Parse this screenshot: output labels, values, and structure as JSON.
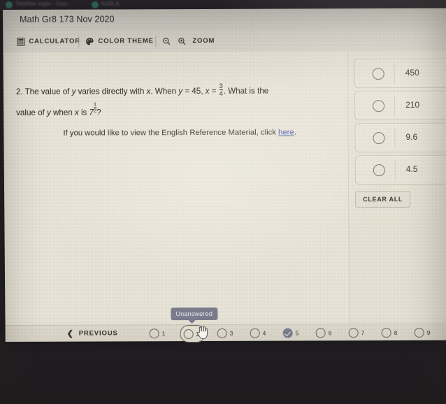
{
  "browser": {
    "tab_1_title": "TestNav login - Goo...",
    "tab_2_title": "NJSLA"
  },
  "assessment": {
    "title": "Math Gr8 173 Nov 2020"
  },
  "toolbar": {
    "calculator_label": "CALCULATOR",
    "calculator_icon": "calculator-icon",
    "color_theme_label": "COLOR THEME",
    "color_theme_icon": "palette-icon",
    "zoom_label": "ZOOM",
    "zoom_out_icon": "magnifier-minus-icon",
    "zoom_in_icon": "magnifier-plus-icon"
  },
  "question": {
    "number": "2.",
    "line1_a": "The value of ",
    "var_y": "y",
    "line1_b": " varies directly with ",
    "var_x": "x",
    "line1_c": ". When ",
    "line1_d": " = 45, ",
    "line1_e": " = ",
    "fraction_numerator": "3",
    "fraction_denominator": "4",
    "line1_f": ". What is the",
    "line2_a": "value of ",
    "line2_b": " when ",
    "line2_c": " is ",
    "mixed_whole": "7",
    "mixed_numerator": "1",
    "mixed_denominator": "2",
    "line2_d": "?",
    "reference_text": "If you would like to view the English Reference Material, click ",
    "reference_link": "here",
    "reference_period": "."
  },
  "answers": {
    "options": [
      {
        "value": "450",
        "selected": false
      },
      {
        "value": "210",
        "selected": false
      },
      {
        "value": "9.6",
        "selected": false
      },
      {
        "value": "4.5",
        "selected": false
      }
    ],
    "clear_all_label": "CLEAR ALL"
  },
  "navigation": {
    "previous_label": "PREVIOUS",
    "previous_icon": "chevron-left-icon",
    "tooltip": "Unanswered",
    "items": [
      {
        "number": "1",
        "state": "unanswered"
      },
      {
        "number": "2",
        "state": "current"
      },
      {
        "number": "3",
        "state": "unanswered"
      },
      {
        "number": "4",
        "state": "unanswered"
      },
      {
        "number": "5",
        "state": "answered"
      },
      {
        "number": "6",
        "state": "unanswered"
      },
      {
        "number": "7",
        "state": "unanswered"
      },
      {
        "number": "8",
        "state": "unanswered"
      },
      {
        "number": "9",
        "state": "unanswered"
      }
    ]
  },
  "colors": {
    "page_background": "#eae5d9",
    "header_background": "#d9d6ce",
    "toolbar_background": "#dedad1",
    "link": "#3b56b5",
    "tooltip_background": "#7b7d90",
    "answered_marker": "#7d7f93",
    "text": "#26241f"
  }
}
